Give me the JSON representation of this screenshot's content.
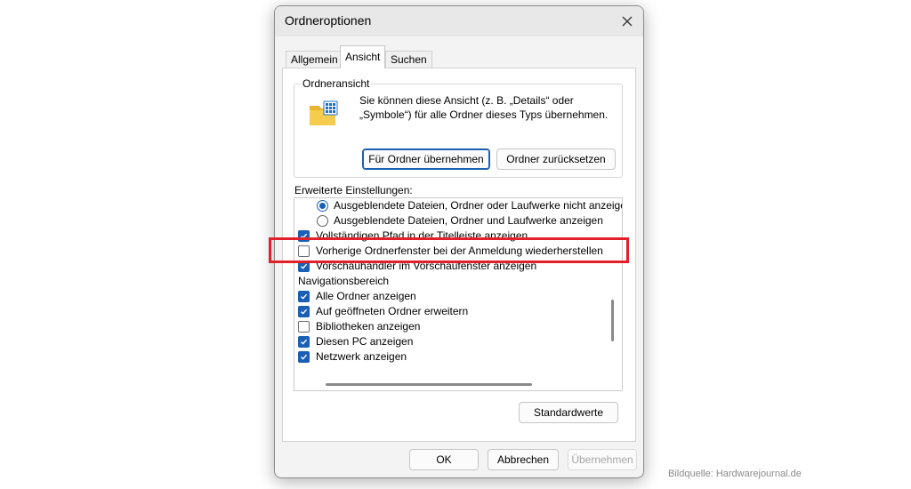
{
  "dialog": {
    "title": "Ordneroptionen",
    "close_icon": "close-icon"
  },
  "tabs": [
    {
      "label": "Allgemein",
      "active": false
    },
    {
      "label": "Ansicht",
      "active": true
    },
    {
      "label": "Suchen",
      "active": false
    }
  ],
  "folder_view": {
    "legend": "Ordneransicht",
    "icon": "folder-icon",
    "description": "Sie können diese Ansicht (z. B. „Details“ oder\n„Symbole“) für alle Ordner dieses Typs übernehmen.",
    "apply_label": "Für Ordner übernehmen",
    "reset_label": "Ordner zurücksetzen"
  },
  "advanced": {
    "label": "Erweiterte Einstellungen:",
    "items": [
      {
        "type": "radio",
        "checked": true,
        "label": "Ausgeblendete Dateien, Ordner oder Laufwerke nicht anzeigen"
      },
      {
        "type": "radio",
        "checked": false,
        "label": "Ausgeblendete Dateien, Ordner und Laufwerke anzeigen"
      },
      {
        "type": "checkbox",
        "checked": true,
        "label": "Vollständigen Pfad in der Titelleiste anzeigen"
      },
      {
        "type": "checkbox",
        "checked": false,
        "label": "Vorherige Ordnerfenster bei der Anmeldung wiederherstellen"
      },
      {
        "type": "checkbox",
        "checked": true,
        "label": "Vorschauhandler im Vorschaufenster anzeigen"
      },
      {
        "type": "header",
        "label": "Navigationsbereich"
      },
      {
        "type": "checkbox",
        "checked": true,
        "label": "Alle Ordner anzeigen"
      },
      {
        "type": "checkbox",
        "checked": true,
        "label": "Auf geöffneten Ordner erweitern"
      },
      {
        "type": "checkbox",
        "checked": false,
        "label": "Bibliotheken anzeigen"
      },
      {
        "type": "checkbox",
        "checked": true,
        "label": "Diesen PC anzeigen"
      },
      {
        "type": "checkbox",
        "checked": true,
        "label": "Netzwerk anzeigen"
      }
    ]
  },
  "defaults_label": "Standardwerte",
  "footer": {
    "ok_label": "OK",
    "cancel_label": "Abbrechen",
    "apply_label": "Übernehmen"
  },
  "credit": "Bildquelle: Hardwarejournal.de",
  "colors": {
    "accent": "#1a5fb4",
    "highlight": "#e2202a"
  }
}
